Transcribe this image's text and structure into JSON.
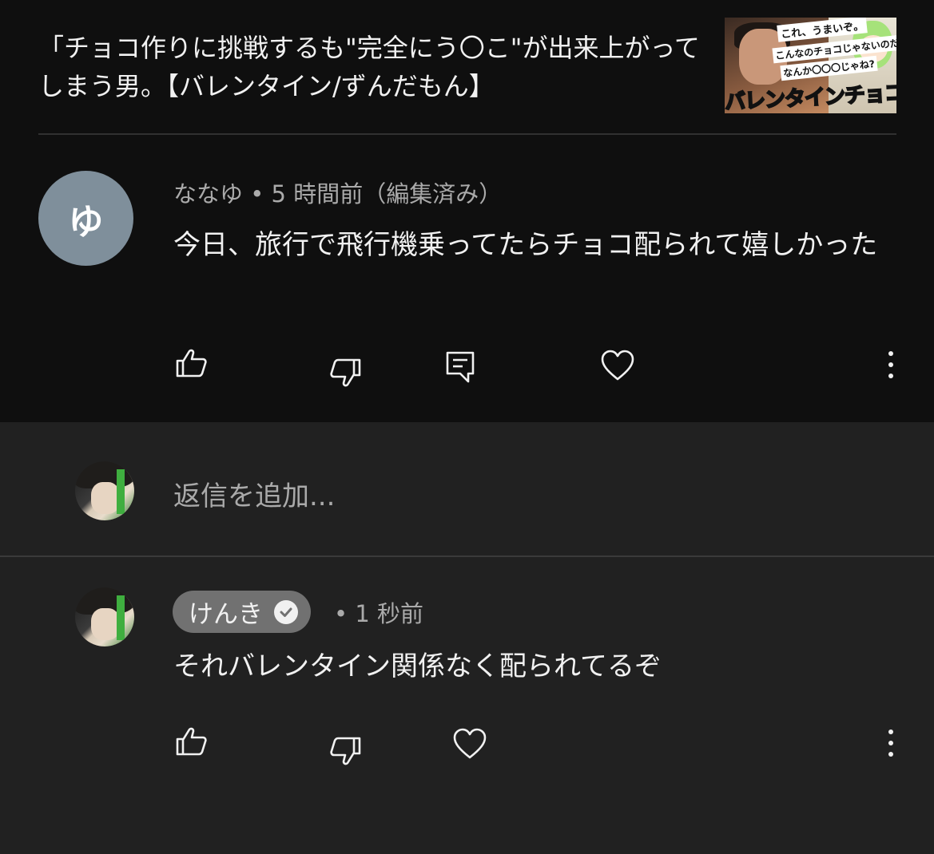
{
  "video": {
    "title": "「チョコ作りに挑戦するも\"完全にう〇こ\"が出来上がってしまう男。【バレンタイン/ずんだもん】",
    "thumbnail": {
      "caption_1": "これ、うまいぞ。",
      "caption_2": "こんなのチョコじゃないのだ",
      "caption_3": "なんか〇〇〇じゃね?",
      "banner": "バレンタインチョコ制作"
    }
  },
  "comment": {
    "avatar_letter": "ゆ",
    "meta": "ななゆ • 5 時間前（編集済み）",
    "text": "今日、旅行で飛行機乗ってたらチョコ配られて嬉しかった",
    "icons": [
      "thumbs-up-icon",
      "thumbs-down-icon",
      "reply-icon",
      "heart-icon",
      "more-vert-icon"
    ]
  },
  "reply_box": {
    "placeholder": "返信を追加..."
  },
  "reply": {
    "author": "けんき",
    "time": "• 1 秒前",
    "text": "それバレンタイン関係なく配られてるぞ",
    "icons": [
      "thumbs-up-icon",
      "thumbs-down-icon",
      "heart-icon",
      "more-vert-icon"
    ]
  },
  "colors": {
    "top_background": "#0f0f0f",
    "page_background": "#212121",
    "secondary_text": "#aaaaaa",
    "avatar_background": "#7f8f9b",
    "author_chip": "#717171"
  }
}
